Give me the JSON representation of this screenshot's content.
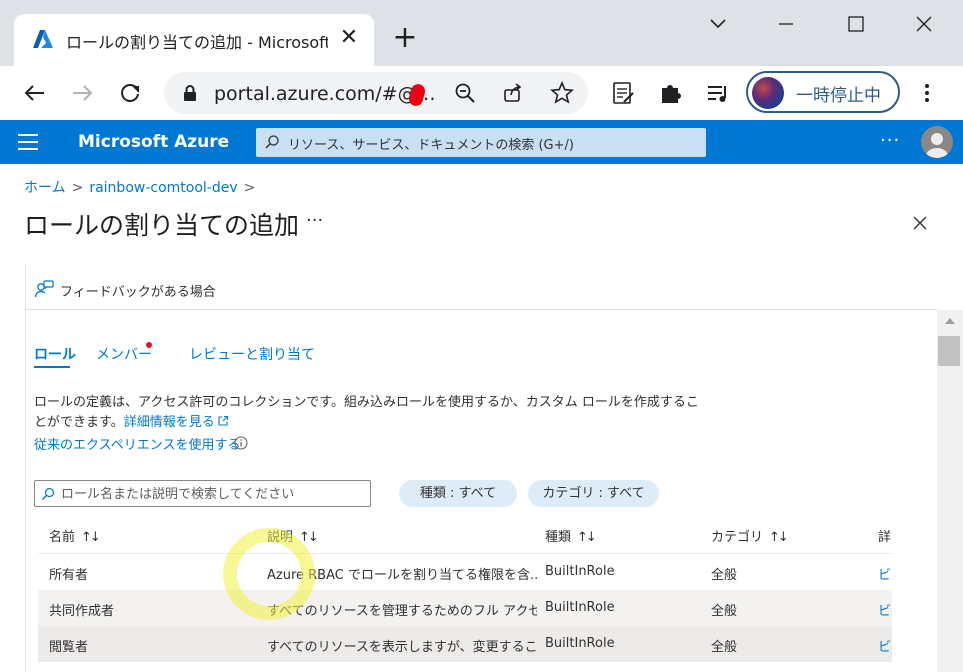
{
  "browser": {
    "tab_title": "ロールの割り当ての追加 - Microsoft Azure",
    "url": "portal.azure.com/#@…",
    "profile_status": "一時停止中"
  },
  "azure": {
    "brand": "Microsoft Azure",
    "search_placeholder": "リソース、サービス、ドキュメントの検索 (G+/)",
    "more": "···",
    "accent_color": "#0078d4"
  },
  "breadcrumb": [
    "ホーム",
    "rainbow-comtool-dev"
  ],
  "page": {
    "title": "ロールの割り当ての追加",
    "more": "···",
    "feedback": "フィードバックがある場合"
  },
  "tabs": [
    {
      "label": "ロール",
      "selected": true
    },
    {
      "label": "メンバー",
      "selected": false,
      "required_dot": true
    },
    {
      "label": "レビューと割り当て",
      "selected": false
    }
  ],
  "description": {
    "text": "ロールの定義は、アクセス許可のコレクションです。組み込みロールを使用するか、カスタム ロールを作成することができます。",
    "learn_more": "詳細情報を見る",
    "classic_link": "従来のエクスペリエンスを使用する"
  },
  "filters": {
    "search_placeholder": "ロール名または説明で検索してください",
    "type_pill": "種類 : すべて",
    "category_pill": "カテゴリ : すべて"
  },
  "table": {
    "columns": [
      "名前",
      "説明",
      "種類",
      "カテゴリ",
      "詳"
    ],
    "rows": [
      {
        "name": "所有者",
        "description": "Azure RBAC でロールを割り当てる権限を含...",
        "type": "BuiltInRole",
        "category": "全般",
        "details": "ビ"
      },
      {
        "name": "共同作成者",
        "description": "すべてのリソースを管理するためのフル アクセス...",
        "type": "BuiltInRole",
        "category": "全般",
        "details": "ビ"
      },
      {
        "name": "閲覧者",
        "description": "すべてのリソースを表示しますが、変更すること...",
        "type": "BuiltInRole",
        "category": "全般",
        "details": "ビ"
      }
    ]
  }
}
